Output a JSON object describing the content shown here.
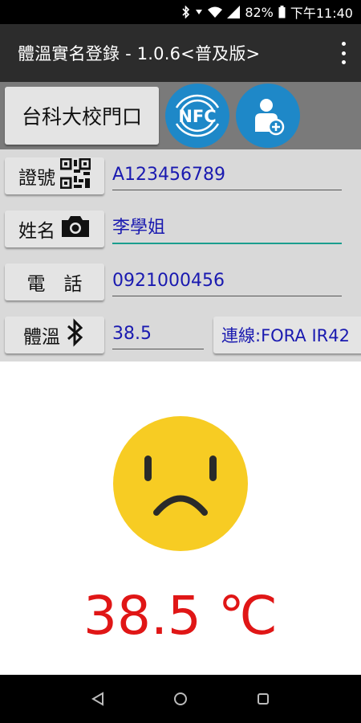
{
  "status_bar": {
    "battery": "82%",
    "time": "下午11:40",
    "icons": [
      "bluetooth-icon",
      "vibrate-icon",
      "wifi-icon",
      "signal-icon",
      "battery-icon"
    ]
  },
  "app_bar": {
    "title": "體溫實名登錄 - 1.0.6<普及版>",
    "menu_icon": "overflow-menu-icon"
  },
  "toolbar": {
    "gate_label": "台科大校門口",
    "nfc_label": "NFC",
    "add_user_icon": "add-user-icon"
  },
  "form": {
    "id": {
      "label": "證號",
      "icon": "qr-code-icon",
      "value": "A123456789"
    },
    "name": {
      "label": "姓名",
      "icon": "camera-icon",
      "value": "李學姐"
    },
    "phone": {
      "label": "電　話",
      "value": "0921000456"
    },
    "temp": {
      "label": "體溫",
      "icon": "bluetooth-icon",
      "value": "38.5"
    },
    "connection": "連線:FORA IR42"
  },
  "result": {
    "face": "sad-face-icon",
    "temperature_display": "38.5 ℃"
  },
  "colors": {
    "accent_blue": "#1e88c8",
    "value_blue": "#1a1ab0",
    "fever_red": "#e01616",
    "face_yellow": "#f7cc23",
    "active_underline": "#1a9e8e"
  },
  "nav_bar": {
    "icons": [
      "back-icon",
      "home-icon",
      "recents-icon"
    ]
  }
}
